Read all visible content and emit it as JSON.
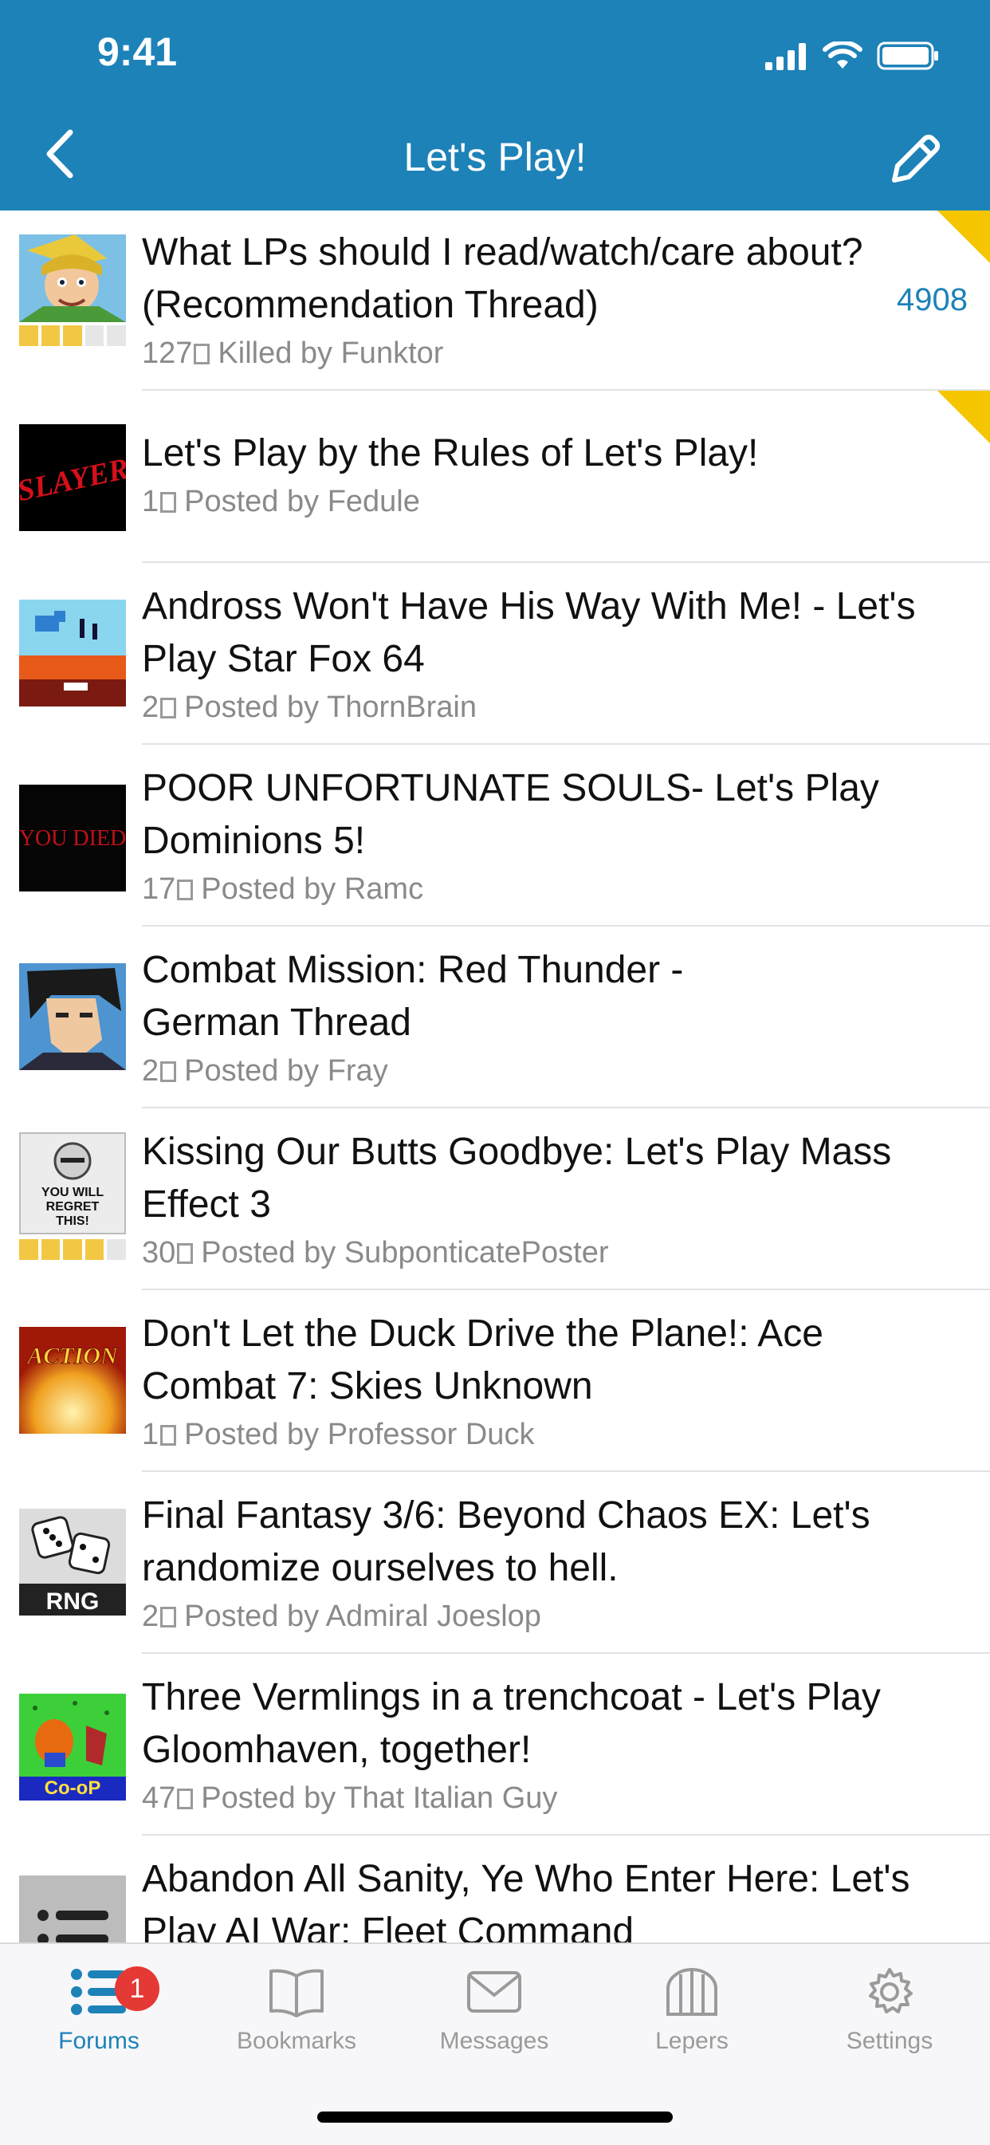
{
  "status": {
    "time": "9:41"
  },
  "nav": {
    "title": "Let's Play!"
  },
  "threads": [
    {
      "title": "What LPs should I read/watch/care about? (Recommendation Thread)",
      "pages": "127",
      "byline": "Killed by Funktor",
      "count": "4908",
      "sticky": true,
      "rating": 3
    },
    {
      "title": "Let's Play by the Rules of Let's Play!",
      "pages": "1",
      "byline": "Posted by Fedule",
      "sticky": true,
      "thumb_text": "SLAYER"
    },
    {
      "title": "Andross Won't Have His Way With Me! - Let's Play Star Fox 64",
      "pages": "2",
      "byline": "Posted by ThornBrain"
    },
    {
      "title": "POOR UNFORTUNATE SOULS- Let's Play Dominions 5!",
      "pages": "17",
      "byline": "Posted by Ramc",
      "thumb_text": "YOU DIED"
    },
    {
      "title": "Combat Mission: Red Thunder - German Thread",
      "pages": "2",
      "byline": "Posted by Fray"
    },
    {
      "title": "Kissing Our Butts Goodbye: Let's Play Mass Effect 3",
      "pages": "30",
      "byline": "Posted by SubponticatePoster",
      "rating": 4,
      "thumb_text": "YOU WILL REGRET THIS!"
    },
    {
      "title": "Don't Let the Duck Drive the Plane!: Ace Combat 7: Skies Unknown",
      "pages": "1",
      "byline": "Posted by Professor Duck",
      "thumb_text": "ACTION"
    },
    {
      "title": "Final Fantasy 3/6: Beyond Chaos EX: Let's randomize ourselves to hell.",
      "pages": "2",
      "byline": "Posted by Admiral Joeslop",
      "thumb_text": "RNG"
    },
    {
      "title": "Three Vermlings in a trenchcoat - Let's Play Gloomhaven, together!",
      "pages": "47",
      "byline": "Posted by That Italian Guy",
      "thumb_text": "Co-oP"
    },
    {
      "title": "Abandon All Sanity, Ye Who Enter Here: Let's Play AI War: Fleet Command",
      "pages": "",
      "byline": ""
    }
  ],
  "tabs": [
    {
      "label": "Forums",
      "badge": "1"
    },
    {
      "label": "Bookmarks"
    },
    {
      "label": "Messages"
    },
    {
      "label": "Lepers"
    },
    {
      "label": "Settings"
    }
  ],
  "colors": {
    "accent": "#1d82b8",
    "sticky": "#f5c600",
    "rating": "#f2c744"
  }
}
